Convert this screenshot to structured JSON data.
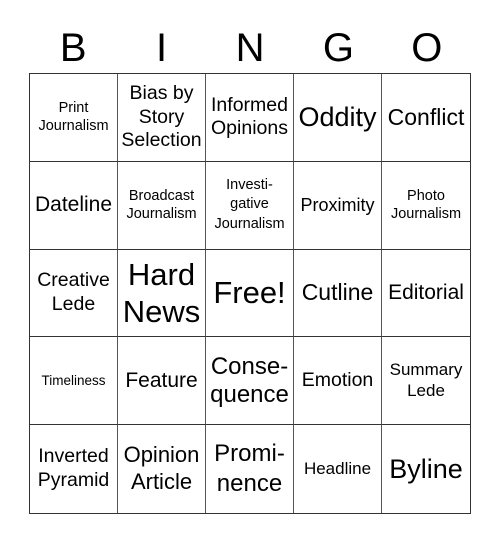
{
  "header": [
    "B",
    "I",
    "N",
    "G",
    "O"
  ],
  "cells": [
    [
      "Print\nJournalism",
      "Bias by\nStory\nSelection",
      "Informed\nOpinions",
      "Oddity",
      "Conflict"
    ],
    [
      "Dateline",
      "Broadcast\nJournalism",
      "Investi-\ngative\nJournalism",
      "Proximity",
      "Photo\nJournalism"
    ],
    [
      "Creative\nLede",
      "Hard\nNews",
      "Free!",
      "Cutline",
      "Editorial"
    ],
    [
      "Timeliness",
      "Feature",
      "Conse-\nquence",
      "Emotion",
      "Summary\nLede"
    ],
    [
      "Inverted\nPyramid",
      "Opinion\nArticle",
      "Promi-\nnence",
      "Headline",
      "Byline"
    ]
  ]
}
